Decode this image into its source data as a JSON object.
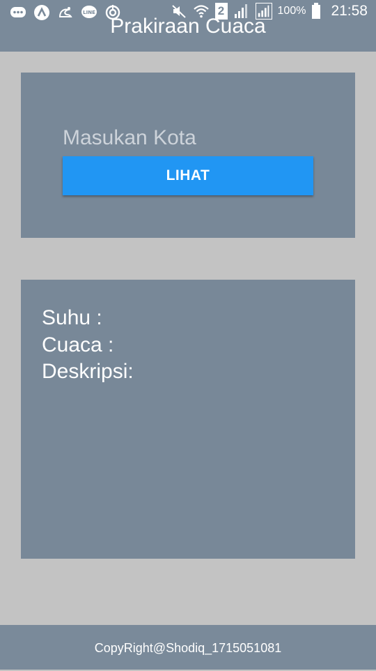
{
  "status_bar": {
    "battery": "100%",
    "time": "21:58",
    "sim_slot": "2",
    "icons_left": [
      "messages-icon",
      "arc-icon",
      "uc-browser-icon",
      "line-icon",
      "sync-icon"
    ],
    "icons_right": [
      "vibrate-mute-icon",
      "wifi-icon",
      "sim-2-icon",
      "signal-icon",
      "signal-2-icon",
      "battery-icon"
    ]
  },
  "app": {
    "title": "Prakiraan Cuaca"
  },
  "form": {
    "city_placeholder": "Masukan Kota",
    "city_value": "",
    "submit_label": "LIHAT"
  },
  "result": {
    "temperature_label": "Suhu :",
    "weather_label": "Cuaca :",
    "description_label": "Deskripsi:"
  },
  "footer": {
    "copyright": "CopyRight@Shodiq_1715051081"
  },
  "colors": {
    "header": "#7a8a9a",
    "card": "#788898",
    "background": "#c3c3c3",
    "button": "#2196f3"
  }
}
